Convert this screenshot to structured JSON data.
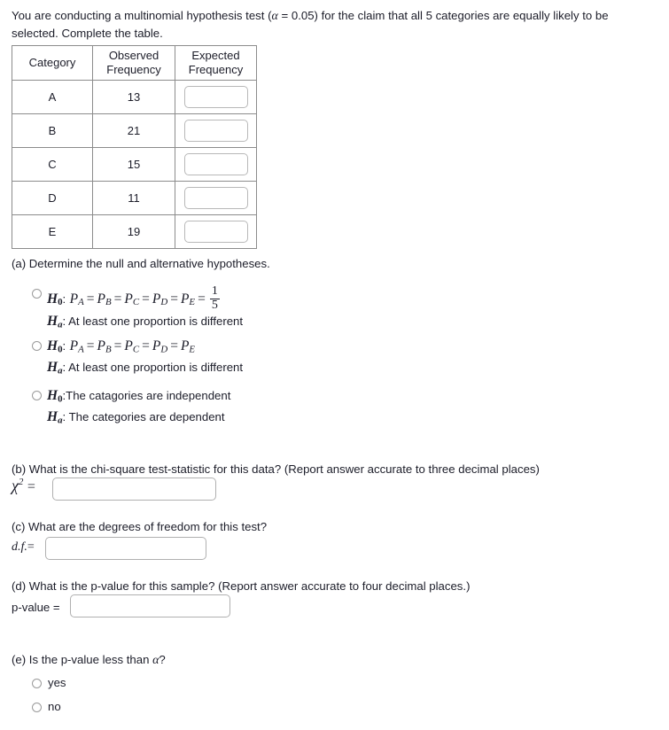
{
  "problem": {
    "intro_before_alpha": "You are conducting a multinomial hypothesis test (",
    "alpha_symbol": "α",
    "intro_after_alpha": " = 0.05) for the claim that all 5 categories are equally likely to be selected. Complete the table.",
    "significance_level": "0.05",
    "num_categories": "5"
  },
  "table": {
    "headers": [
      "Category",
      "Observed Frequency",
      "Expected Frequency"
    ],
    "header_lines": [
      [
        "Category"
      ],
      [
        "Observed",
        "Frequency"
      ],
      [
        "Expected",
        "Frequency"
      ]
    ],
    "rows": [
      {
        "category": "A",
        "observed": "13",
        "expected": ""
      },
      {
        "category": "B",
        "observed": "21",
        "expected": ""
      },
      {
        "category": "C",
        "observed": "15",
        "expected": ""
      },
      {
        "category": "D",
        "observed": "11",
        "expected": ""
      },
      {
        "category": "E",
        "observed": "19",
        "expected": ""
      }
    ]
  },
  "part_a": {
    "prompt": "(a) Determine the null and alternative hypotheses.",
    "options": [
      {
        "id": "option-1",
        "selected": false,
        "null_label": "H",
        "null_sub": "0",
        "proportions": [
          "P",
          "P",
          "P",
          "P",
          "P"
        ],
        "prop_subs": [
          "A",
          "B",
          "C",
          "D",
          "E"
        ],
        "equals": "=",
        "fraction_numerator": "1",
        "fraction_denominator": "5",
        "alt_label": "H",
        "alt_sub": "a",
        "alt_text": ": At least one proportion is different"
      },
      {
        "id": "option-2",
        "selected": false,
        "null_label": "H",
        "null_sub": "0",
        "proportions": [
          "P",
          "P",
          "P",
          "P",
          "P"
        ],
        "prop_subs": [
          "A",
          "B",
          "C",
          "D",
          "E"
        ],
        "equals": "=",
        "alt_label": "H",
        "alt_sub": "a",
        "alt_text": ": At least one proportion is different"
      },
      {
        "id": "option-3",
        "selected": false,
        "null_label": "H",
        "null_sub": "0",
        "null_text": ":The catagories are independent",
        "alt_label": "H",
        "alt_sub": "a",
        "alt_text": ": The categories are dependent"
      }
    ]
  },
  "part_b": {
    "prompt": "(b) What is the chi-square test-statistic for this data? (Report answer accurate to three decimal places)",
    "label_symbol": "χ",
    "label_exponent": "2",
    "label_equals": "=",
    "value": ""
  },
  "part_c": {
    "prompt": "(c) What are the degrees of freedom for this test?",
    "label_math": "d.f.",
    "label_equals": "=",
    "value": ""
  },
  "part_d": {
    "prompt": "(d) What is the p-value for this sample? (Report answer accurate to four decimal places.)",
    "label": "p-value =",
    "value": ""
  },
  "part_e": {
    "prompt_before_alpha": "(e) Is the p-value less than ",
    "alpha_symbol": "α",
    "prompt_after_alpha": "?",
    "options": [
      {
        "id": "yes",
        "label": "yes",
        "selected": false
      },
      {
        "id": "no",
        "label": "no",
        "selected": false
      }
    ]
  }
}
